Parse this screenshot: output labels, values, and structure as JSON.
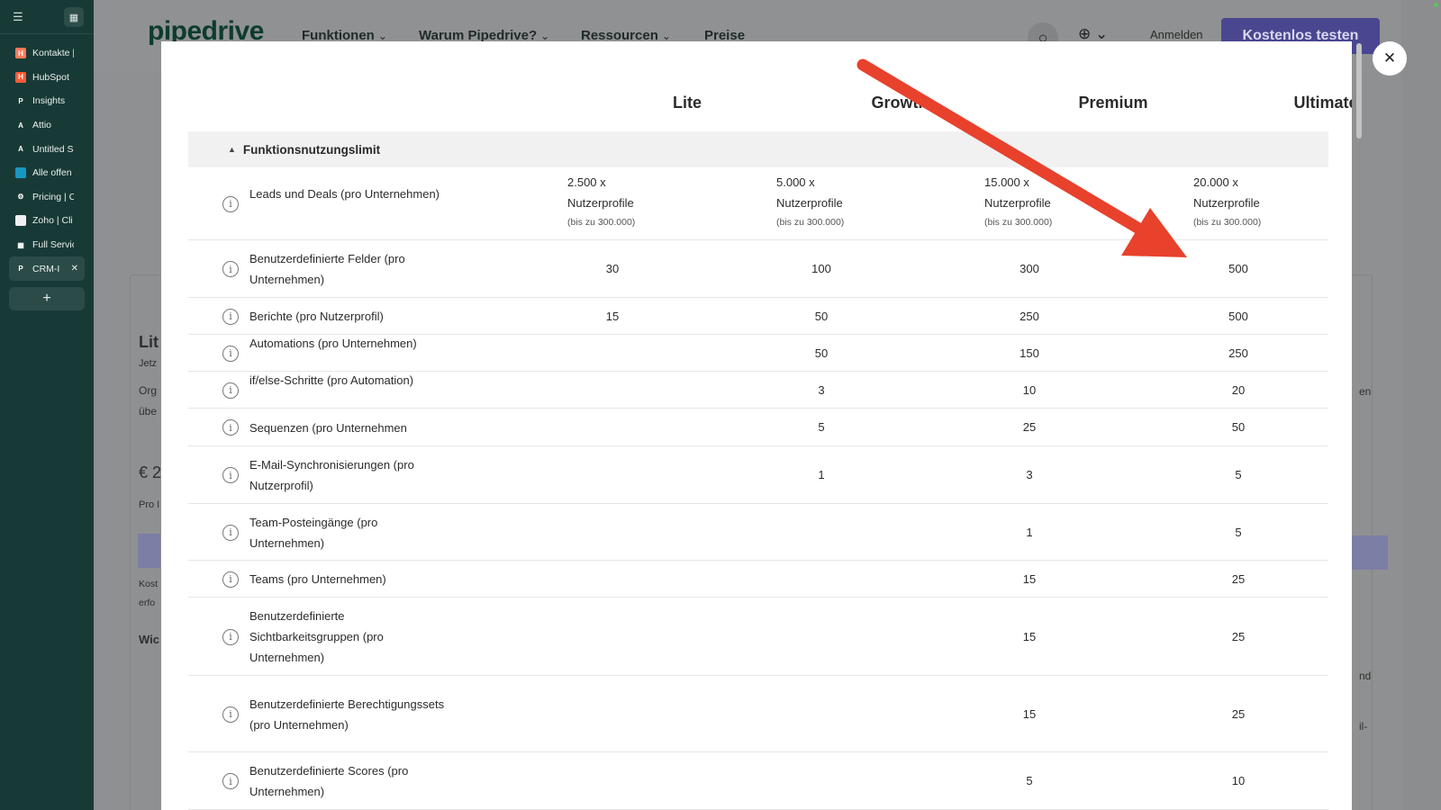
{
  "sidebar": {
    "items": [
      {
        "label": "Kontakte |",
        "icon": "hubspot-icon",
        "color": "#ff7a59",
        "glyph": "H"
      },
      {
        "label": "HubSpot",
        "icon": "hubspot-icon",
        "color": "#ff5c35",
        "glyph": "H"
      },
      {
        "label": "Insights",
        "icon": "pipedrive-icon",
        "color": "#183a37",
        "glyph": "P"
      },
      {
        "label": "Attio",
        "icon": "attio-icon",
        "color": "#183a37",
        "glyph": "A"
      },
      {
        "label": "Untitled S",
        "icon": "attio-icon",
        "color": "#183a37",
        "glyph": "A"
      },
      {
        "label": "Alle offen",
        "icon": "salesforce-icon",
        "color": "#1798c1",
        "glyph": ""
      },
      {
        "label": "Pricing | C",
        "icon": "gear-icon",
        "color": "#183a37",
        "glyph": "⚙"
      },
      {
        "label": "Zoho | Cli",
        "icon": "zoho-icon",
        "color": "#f0f0f0",
        "glyph": ""
      },
      {
        "label": "Full Servic",
        "icon": "grid-icon",
        "color": "#183a37",
        "glyph": "▦"
      },
      {
        "label": "CRM-I",
        "icon": "pipedrive-icon",
        "color": "#2b4b48",
        "glyph": "P"
      }
    ]
  },
  "nav": {
    "logo": "pipedrive",
    "items": [
      "Funktionen",
      "Warum Pipedrive?",
      "Ressourcen",
      "Preise"
    ],
    "login": "Anmelden",
    "cta": "Kostenlos testen"
  },
  "background": {
    "fragments": [
      "Lit",
      "Jetz",
      "Org",
      "übe",
      "€ 2",
      "Pro I",
      "Kost",
      "erfo",
      "Wic",
      "en",
      "nd",
      "il-"
    ]
  },
  "modal": {
    "plans": [
      "Lite",
      "Growth",
      "Premium",
      "Ultimate"
    ],
    "section_title": "Funktionsnutzungslimit",
    "rows": [
      {
        "feature": "Leads und Deals (pro Unternehmen)",
        "values": [
          {
            "main": "2.500 x Nutzerprofile",
            "sub": "(bis zu 300.000)"
          },
          {
            "main": "5.000 x Nutzerprofile",
            "sub": "(bis zu 300.000)"
          },
          {
            "main": "15.000 x Nutzerprofile",
            "sub": "(bis zu 300.000)"
          },
          {
            "main": "20.000 x Nutzerprofile",
            "sub": "(bis zu 300.000)"
          }
        ]
      },
      {
        "feature": "Benutzerdefinierte Felder (pro Unternehmen)",
        "values": [
          "30",
          "100",
          "300",
          "500"
        ]
      },
      {
        "feature": "Berichte (pro Nutzerprofil)",
        "values": [
          "15",
          "50",
          "250",
          "500"
        ]
      },
      {
        "feature": "Automations (pro Unternehmen)",
        "values": [
          "",
          "50",
          "150",
          "250"
        ]
      },
      {
        "feature": "if/else-Schritte (pro Automation)",
        "values": [
          "",
          "3",
          "10",
          "20"
        ]
      },
      {
        "feature": "Sequenzen (pro Unternehmen",
        "values": [
          "",
          "5",
          "25",
          "50"
        ]
      },
      {
        "feature": "E-Mail-Synchronisierungen (pro Nutzerprofil)",
        "values": [
          "",
          "1",
          "3",
          "5"
        ]
      },
      {
        "feature": "Team-Posteingänge (pro Unternehmen)",
        "values": [
          "",
          "",
          "1",
          "5"
        ]
      },
      {
        "feature": "Teams (pro Unternehmen)",
        "values": [
          "",
          "",
          "15",
          "25"
        ]
      },
      {
        "feature": "Benutzerdefinierte Sichtbarkeitsgruppen (pro Unternehmen)",
        "values": [
          "",
          "",
          "15",
          "25"
        ]
      },
      {
        "feature": "Benutzerdefinierte Berechtigungssets (pro Unternehmen)",
        "values": [
          "",
          "",
          "15",
          "25"
        ]
      },
      {
        "feature": "Benutzerdefinierte Scores (pro Unternehmen)",
        "values": [
          "",
          "",
          "5",
          "10"
        ]
      }
    ]
  },
  "colors": {
    "brand": "#0d3b2f",
    "cta": "#4a4790",
    "annotation_arrow": "#e8412c"
  }
}
